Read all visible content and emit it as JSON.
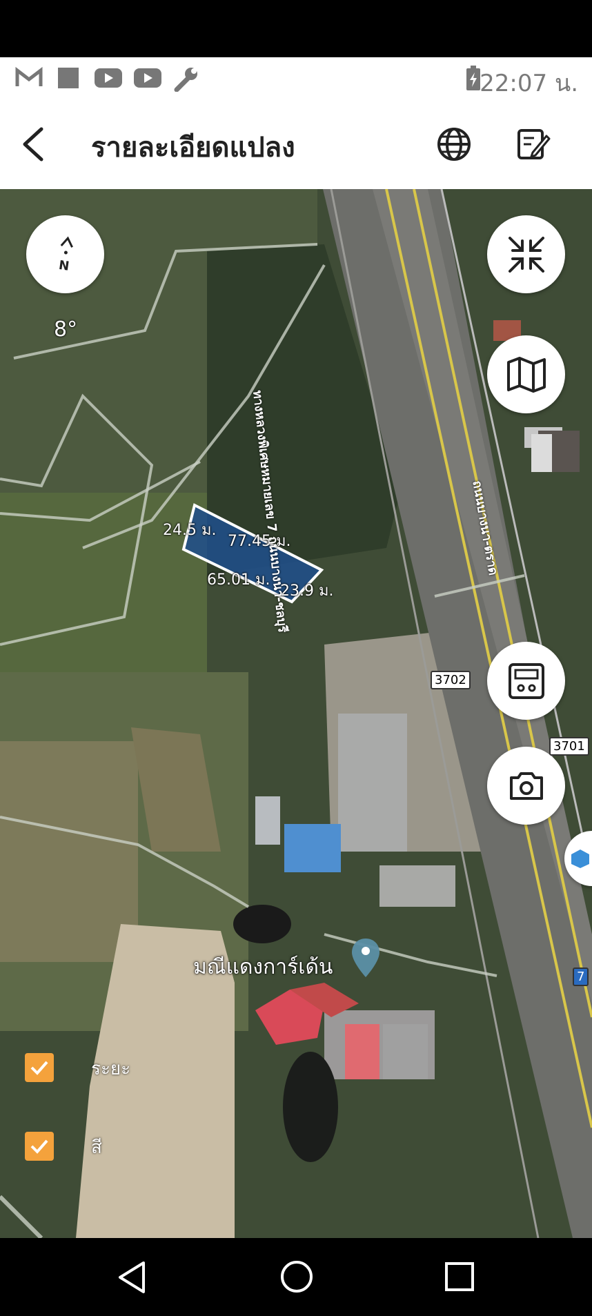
{
  "status_bar": {
    "time": "22:07 น.",
    "icons": [
      "gmail-icon",
      "app-square-icon",
      "youtube-icon",
      "youtube-icon",
      "wrench-icon",
      "battery-charging-icon"
    ]
  },
  "app_bar": {
    "title": "รายละเอียดแปลง",
    "back_icon": "back-arrow-icon",
    "globe_icon": "globe-icon",
    "edit_icon": "edit-note-icon"
  },
  "map": {
    "compass": {
      "label": "N",
      "rotation": "8°"
    },
    "parcel": {
      "color": "#1e4f8c",
      "edges": [
        "24.5 ม.",
        "77.45 ม.",
        "65.01 ม.",
        "23.9 ม."
      ]
    },
    "road_labels": [
      "ทางหลวงพิเศษหมายเลข 7 ถนนบางนา-ชลบุรี",
      "ถนนบางนา-ตราด"
    ],
    "road_shields": [
      "3702",
      "3701",
      "7"
    ],
    "place": "มณีแดงการ์เด้น",
    "controls": [
      "collapse-icon",
      "map-layers-icon",
      "calculator-icon",
      "camera-icon"
    ]
  },
  "toggles": [
    {
      "label": "ระยะ",
      "checked": true
    },
    {
      "label": "สี",
      "checked": true
    }
  ],
  "colors": {
    "accent": "#f4a23c",
    "parcel": "#1e4f8c"
  }
}
